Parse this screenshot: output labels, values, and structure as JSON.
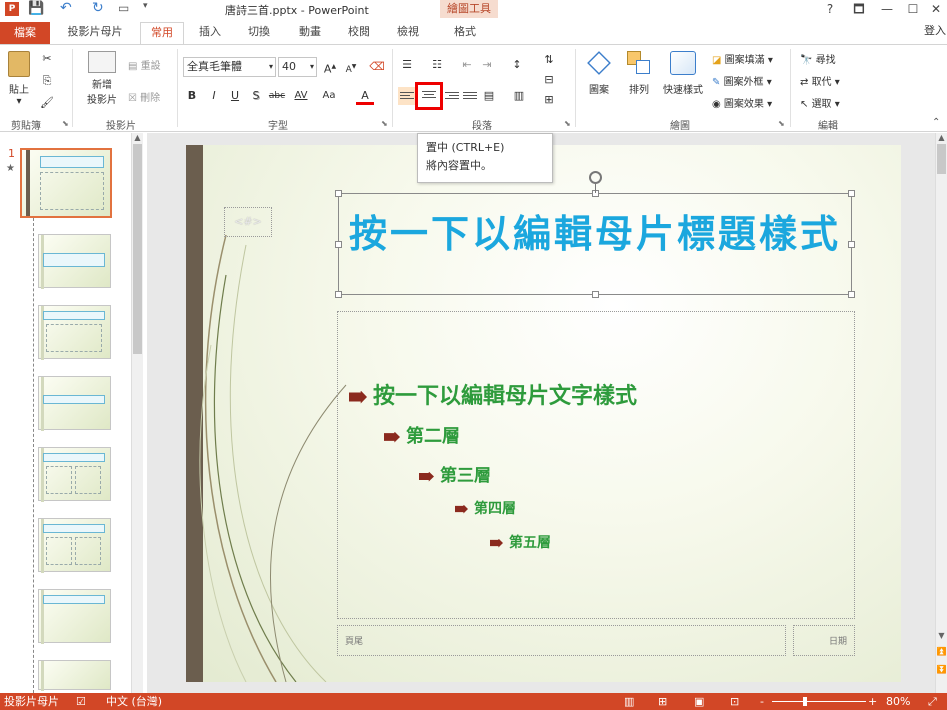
{
  "window": {
    "title": "唐詩三首.pptx - PowerPoint",
    "context_tool": "繪圖工具",
    "help": "?",
    "controls": [
      "🗖",
      "—",
      "☐",
      "✕"
    ],
    "user": "登入"
  },
  "tabs": {
    "file": "檔案",
    "items": [
      "投影片母片",
      "常用",
      "插入",
      "切換",
      "動畫",
      "校閱",
      "檢視",
      "格式"
    ]
  },
  "ribbon": {
    "clipboard": {
      "label": "剪貼簿",
      "paste": "貼上"
    },
    "slides": {
      "label": "投影片",
      "new_slide_1": "新增",
      "new_slide_2": "投影片",
      "reset": "重設",
      "delete": "刪除"
    },
    "font": {
      "label": "字型",
      "font_name": "全真毛筆體",
      "font_size": "40",
      "bold": "B",
      "italic": "I",
      "underline": "U",
      "shadow": "S",
      "strike": "abc",
      "spacing": "AV",
      "case": "Aa",
      "color": "A"
    },
    "paragraph": {
      "label": "段落"
    },
    "drawing": {
      "label": "繪圖",
      "shapes": "圖案",
      "arrange": "排列",
      "quick_styles": "快速樣式",
      "shape_fill": "圖案填滿",
      "shape_outline": "圖案外框",
      "shape_effects": "圖案效果"
    },
    "editing": {
      "label": "編輯",
      "find": "尋找",
      "replace": "取代",
      "select": "選取"
    }
  },
  "tooltip": {
    "title": "置中 (CTRL+E)",
    "desc": "將內容置中。"
  },
  "slide_pane": {
    "selected_number": "1",
    "star": "★"
  },
  "slide": {
    "date_placeholder": "<#>",
    "title": "按一下以編輯母片標題樣式",
    "levels": [
      "按一下以編輯母片文字樣式",
      "第二層",
      "第三層",
      "第四層",
      "第五層"
    ],
    "footer": "頁尾",
    "date_right": "日期"
  },
  "status": {
    "mode": "投影片母片",
    "language": "中文 (台灣)",
    "zoom": "80%",
    "zoom_minus": "-",
    "zoom_plus": "+"
  },
  "colors": {
    "accent": "#d24726",
    "title_blue": "#1ba7de",
    "body_green": "#2e9b3c",
    "bullet": "#8b2a1e"
  }
}
